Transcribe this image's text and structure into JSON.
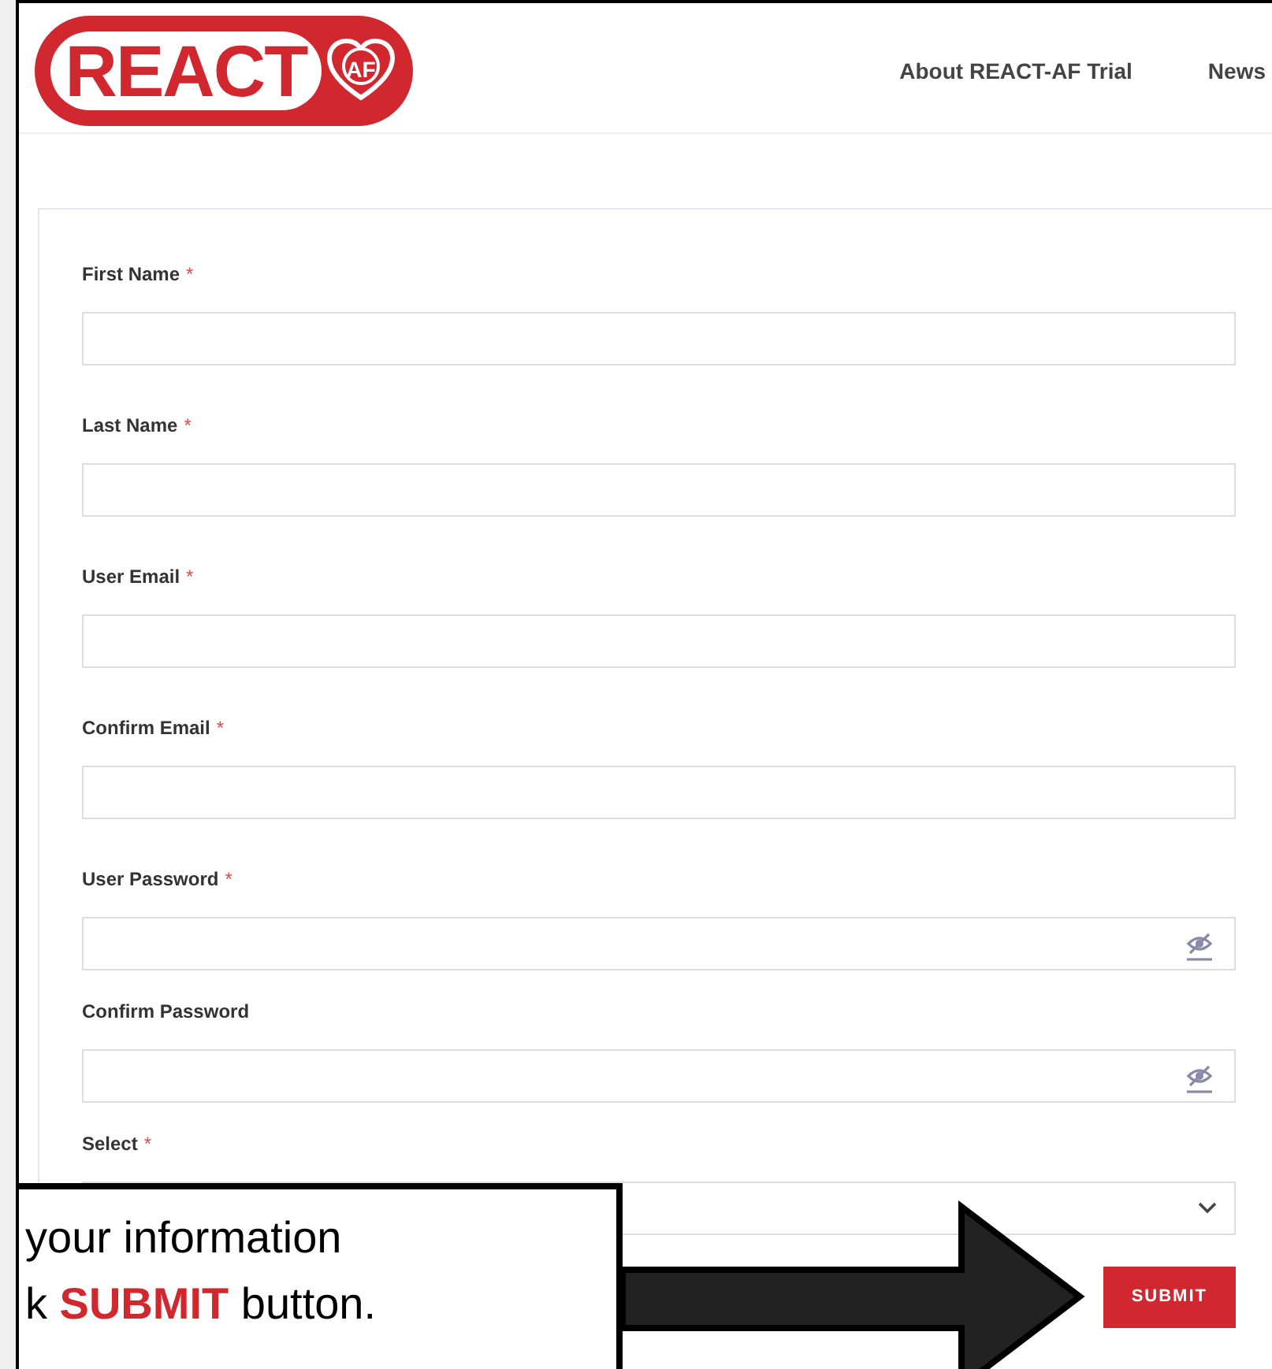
{
  "logo": {
    "text": "REACT",
    "badge": "AF"
  },
  "nav": [
    {
      "label": "About REACT-AF Trial"
    },
    {
      "label": "News"
    }
  ],
  "form": {
    "fields": [
      {
        "label": "First Name",
        "required_mark": "*",
        "kind": "text"
      },
      {
        "label": "Last Name",
        "required_mark": "*",
        "kind": "text"
      },
      {
        "label": "User Email",
        "required_mark": "*",
        "kind": "text"
      },
      {
        "label": "Confirm Email",
        "required_mark": "*",
        "kind": "text"
      },
      {
        "label": "User Password",
        "required_mark": "*",
        "kind": "password"
      },
      {
        "label": "Confirm Password",
        "kind": "password"
      },
      {
        "label": "Select",
        "required_mark": "*",
        "kind": "select"
      }
    ],
    "submit": "SUBMIT"
  },
  "callout": {
    "lines": [
      "your information",
      "k **SUBMIT** button."
    ]
  }
}
